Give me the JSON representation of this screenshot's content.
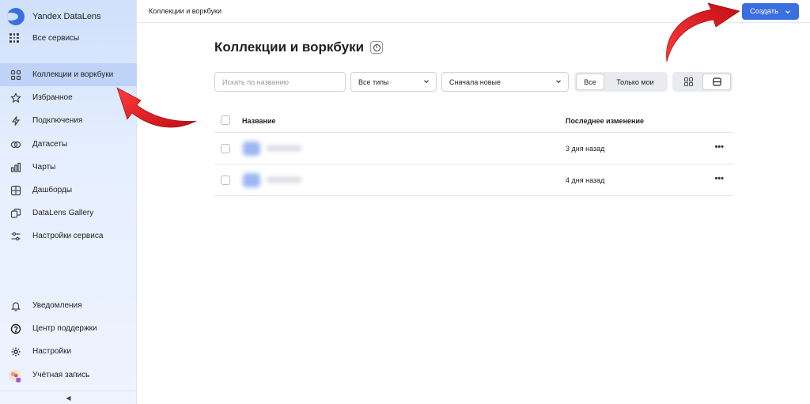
{
  "app": {
    "name": "Yandex DataLens",
    "all_services": "Все сервисы"
  },
  "sidebar": {
    "items": [
      {
        "label": "Коллекции и воркбуки",
        "icon": "collections-icon",
        "active": true
      },
      {
        "label": "Избранное",
        "icon": "star-icon",
        "active": false
      },
      {
        "label": "Подключения",
        "icon": "bolt-icon",
        "active": false
      },
      {
        "label": "Датасеты",
        "icon": "dataset-icon",
        "active": false
      },
      {
        "label": "Чарты",
        "icon": "chart-icon",
        "active": false
      },
      {
        "label": "Дашборды",
        "icon": "dashboard-icon",
        "active": false
      },
      {
        "label": "DataLens Gallery",
        "icon": "gallery-icon",
        "active": false
      },
      {
        "label": "Настройки сервиса",
        "icon": "sliders-icon",
        "active": false
      }
    ],
    "bottom": [
      {
        "label": "Уведомления",
        "icon": "bell-icon"
      },
      {
        "label": "Центр поддержки",
        "icon": "help-icon"
      },
      {
        "label": "Настройки",
        "icon": "gear-icon"
      },
      {
        "label": "Учётная запись",
        "icon": "avatar-icon"
      }
    ],
    "collapse": "◀"
  },
  "header": {
    "breadcrumb": "Коллекции и воркбуки",
    "create_label": "Создать"
  },
  "main": {
    "title": "Коллекции и воркбуки",
    "search_placeholder": "Искать по названию",
    "type_filter": "Все типы",
    "sort_filter": "Сначала новые",
    "segment_all": "Все",
    "segment_mine": "Только мои",
    "table": {
      "col_name": "Название",
      "col_changed": "Последнее изменение",
      "rows": [
        {
          "changed": "3 дня назад"
        },
        {
          "changed": "4 дня назад"
        }
      ]
    }
  },
  "colors": {
    "accent": "#3b6fe0",
    "arrow": "#e0141b"
  }
}
